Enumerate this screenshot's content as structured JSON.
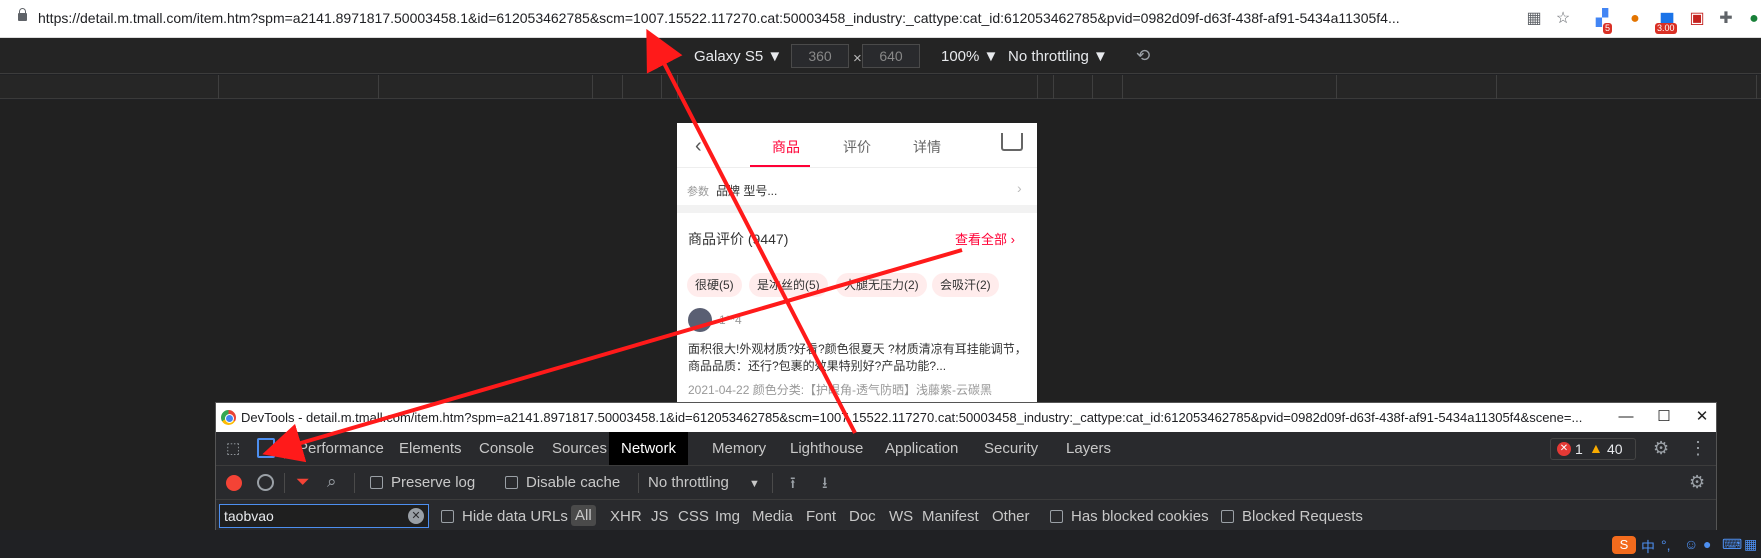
{
  "address_bar": {
    "url": "https://detail.m.tmall.com/item.htm?spm=a2141.8971817.50003458.1&id=612053462785&scm=1007.15522.117270.cat:50003458_industry:_cattype:cat_id:612053462785&pvid=0982d09f-d63f-438f-af91-5434a11305f4...",
    "ext_badge_1": "5",
    "ext_badge_2": "3.00"
  },
  "device_toolbar": {
    "device": "Galaxy S5",
    "width": "360",
    "height": "640",
    "times": "×",
    "zoom": "100%",
    "throttling": "No throttling"
  },
  "page": {
    "tabs": [
      "商品",
      "评价",
      "详情"
    ],
    "active_tab": 0,
    "param_label": "参数",
    "param_value": "品牌 型号...",
    "review_header": "商品评价 (9447)",
    "see_all": "查看全部",
    "tags": [
      "很硬(5)",
      "是冰丝的(5)",
      "大腿无压力(2)",
      "会吸汗(2)"
    ],
    "reviewer_name": "1**4",
    "review_text": "面积很大!外观材质?好看?颜色很夏天 ?材质清凉有耳挂能调节，商品品质：还行?包裹的效果特别好?产品功能?...",
    "review_meta": "2021-04-22 颜色分类:【护眼角-透气防晒】浅藤紫-云碳黑"
  },
  "devtools": {
    "title": "DevTools - detail.m.tmall.com/item.htm?spm=a2141.8971817.50003458.1&id=612053462785&scm=1007.15522.117270.cat:50003458_industry:_cattype:cat_id:612053462785&pvid=0982d09f-d63f-438f-af91-5434a11305f4&scene=...",
    "tabs": [
      "Performance",
      "Elements",
      "Console",
      "Sources",
      "Network",
      "Memory",
      "Lighthouse",
      "Application",
      "Security",
      "Layers"
    ],
    "active_tab": "Network",
    "error_count": "1",
    "warning_count": "40",
    "preserve_log": "Preserve log",
    "disable_cache": "Disable cache",
    "throttling": "No throttling",
    "filter_value": "taobvao",
    "hide_data_urls": "Hide data URLs",
    "filter_types": [
      "All",
      "XHR",
      "JS",
      "CSS",
      "Img",
      "Media",
      "Font",
      "Doc",
      "WS",
      "Manifest",
      "Other"
    ],
    "has_blocked_cookies": "Has blocked cookies",
    "blocked_requests": "Blocked Requests"
  },
  "taskbar": {
    "ime": "中"
  },
  "colors": {
    "accent_red": "#ff0036",
    "annotation_red": "#ff1a1a",
    "devtools_bg": "#292a2d"
  }
}
